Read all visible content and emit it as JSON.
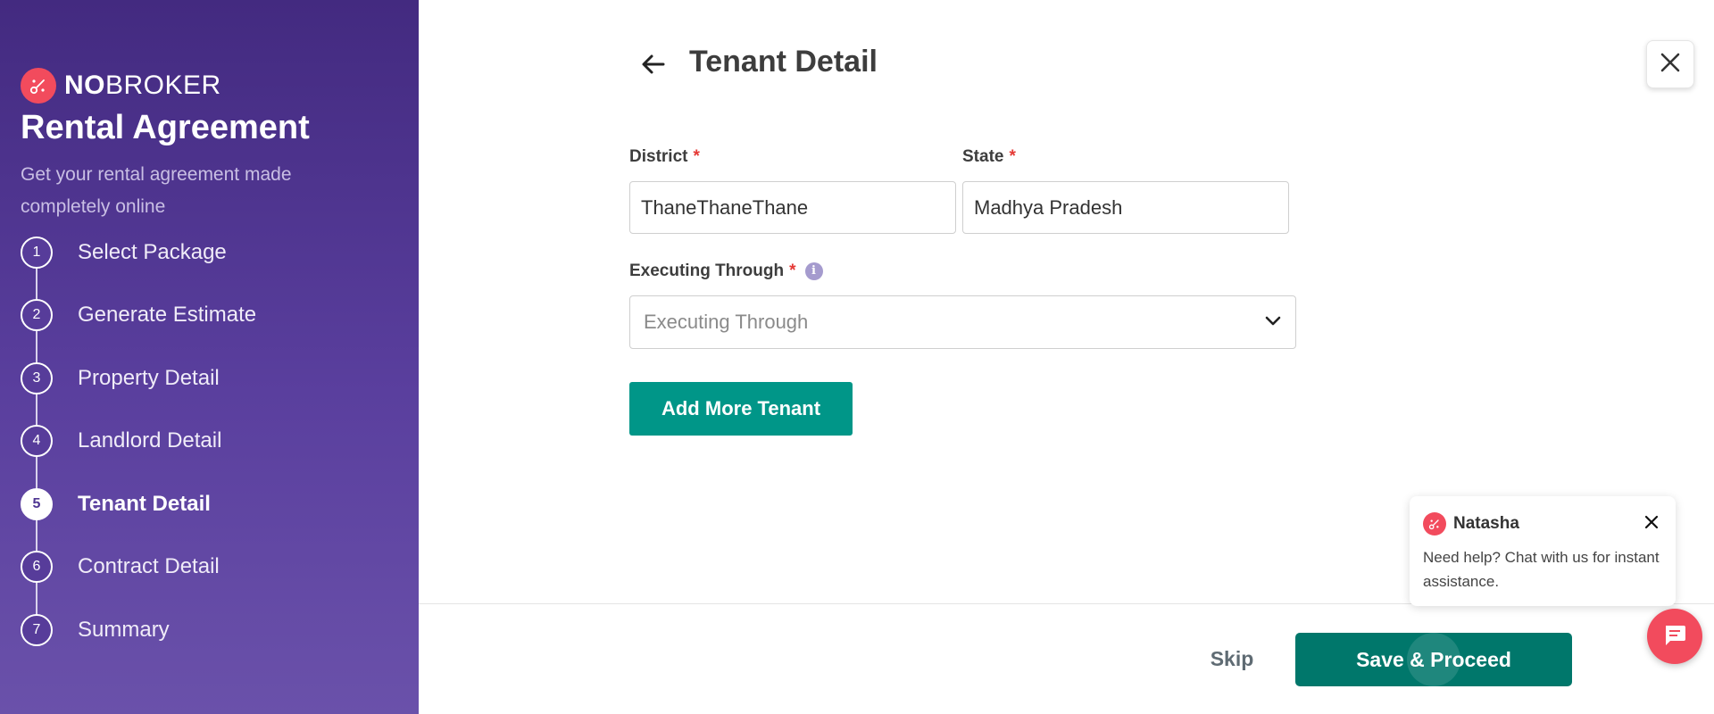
{
  "brand": {
    "name_bold": "NO",
    "name_rest": "BROKER",
    "logo_icon": "nobroker-logo-icon"
  },
  "sidebar": {
    "title": "Rental Agreement",
    "subtitle": "Get your rental agreement made completely online",
    "steps": [
      {
        "num": "1",
        "label": "Select Package",
        "active": false
      },
      {
        "num": "2",
        "label": "Generate Estimate",
        "active": false
      },
      {
        "num": "3",
        "label": "Property Detail",
        "active": false
      },
      {
        "num": "4",
        "label": "Landlord Detail",
        "active": false
      },
      {
        "num": "5",
        "label": "Tenant Detail",
        "active": true
      },
      {
        "num": "6",
        "label": "Contract Detail",
        "active": false
      },
      {
        "num": "7",
        "label": "Summary",
        "active": false
      }
    ]
  },
  "header": {
    "title": "Tenant Detail",
    "back_icon": "arrow-left-icon",
    "close_icon": "close-icon"
  },
  "form": {
    "district": {
      "label": "District",
      "required": "*",
      "value": "ThaneThaneThane"
    },
    "state": {
      "label": "State",
      "required": "*",
      "value": "Madhya Pradesh"
    },
    "executing_through": {
      "label": "Executing Through",
      "required": "*",
      "info": "i",
      "placeholder": "Executing Through"
    },
    "add_more_label": "Add More Tenant"
  },
  "footer": {
    "skip_label": "Skip",
    "save_label": "Save & Proceed"
  },
  "chat": {
    "name": "Natasha",
    "message": "Need help? Chat with us for instant assistance.",
    "close_icon": "close-icon",
    "fab_icon": "chat-bubble-icon"
  },
  "colors": {
    "primary": "#009688",
    "save": "#00776b",
    "brand": "#f24b5d",
    "sidebar": "#4b3290"
  }
}
